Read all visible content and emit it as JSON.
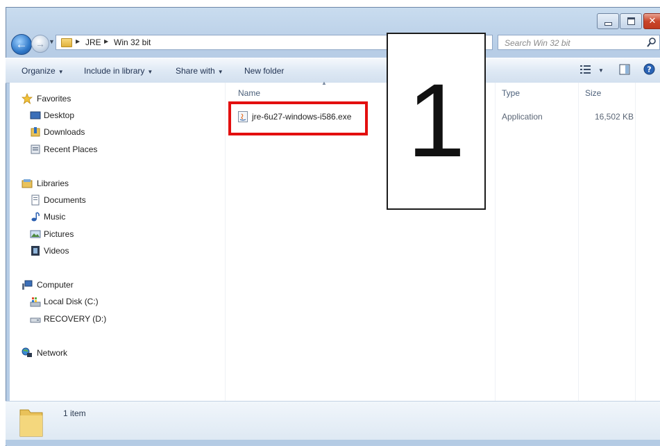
{
  "window": {
    "caption_buttons": [
      "minimize",
      "maximize",
      "close"
    ]
  },
  "address_bar": {
    "breadcrumbs": [
      "JRE",
      "Win 32 bit"
    ]
  },
  "search": {
    "placeholder": "Search Win 32 bit"
  },
  "toolbar": {
    "organize": "Organize",
    "include_in_library": "Include in library",
    "share_with": "Share with",
    "new_folder": "New folder"
  },
  "nav_pane": {
    "favorites": {
      "label": "Favorites",
      "items": [
        {
          "label": "Desktop",
          "icon": "desktop-icon"
        },
        {
          "label": "Downloads",
          "icon": "downloads-icon"
        },
        {
          "label": "Recent Places",
          "icon": "recent-places-icon"
        }
      ]
    },
    "libraries": {
      "label": "Libraries",
      "items": [
        {
          "label": "Documents",
          "icon": "documents-icon"
        },
        {
          "label": "Music",
          "icon": "music-icon"
        },
        {
          "label": "Pictures",
          "icon": "pictures-icon"
        },
        {
          "label": "Videos",
          "icon": "videos-icon"
        }
      ]
    },
    "computer": {
      "label": "Computer",
      "items": [
        {
          "label": "Local Disk (C:)",
          "icon": "local-disk-icon"
        },
        {
          "label": "RECOVERY (D:)",
          "icon": "drive-icon"
        }
      ]
    },
    "network": {
      "label": "Network"
    }
  },
  "file_list": {
    "columns": {
      "name": "Name",
      "type": "Type",
      "size": "Size"
    },
    "files": [
      {
        "name": "jre-6u27-windows-i586.exe",
        "type": "Application",
        "size": "16,502 KB"
      }
    ]
  },
  "annotation": {
    "step_number": "1",
    "highlight_color": "#e30f0f"
  },
  "status": {
    "item_count": "1 item"
  },
  "colors": {
    "accent": "#2f78c8",
    "frame": "#b7cde6"
  }
}
